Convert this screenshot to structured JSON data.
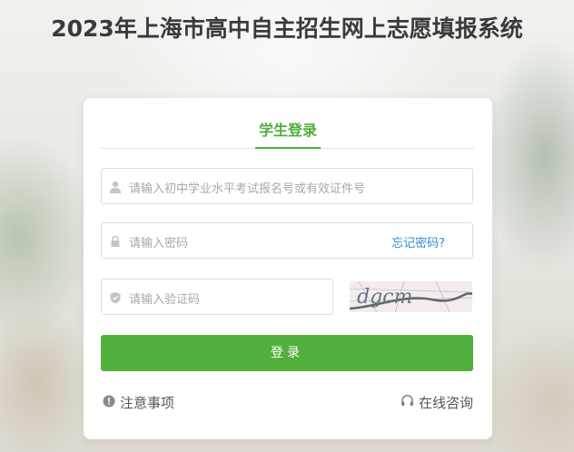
{
  "page": {
    "title": "2023年上海市高中自主招生网上志愿填报系统"
  },
  "login": {
    "tab_label": "学生登录",
    "username_placeholder": "请输入初中学业水平考试报名号或有效证件号",
    "password_placeholder": "请输入密码",
    "forgot_password": "忘记密码?",
    "captcha_placeholder": "请输入验证码",
    "captcha_text": "dgcm",
    "submit_label": "登录"
  },
  "footer": {
    "notice_label": "注意事项",
    "consult_label": "在线咨询"
  },
  "colors": {
    "accent": "#52b03e",
    "link": "#2e8fd6"
  },
  "icons": {
    "username": "user-icon",
    "password": "lock-icon",
    "captcha": "shield-icon",
    "notice": "exclamation-circle-icon",
    "consult": "headset-icon"
  }
}
